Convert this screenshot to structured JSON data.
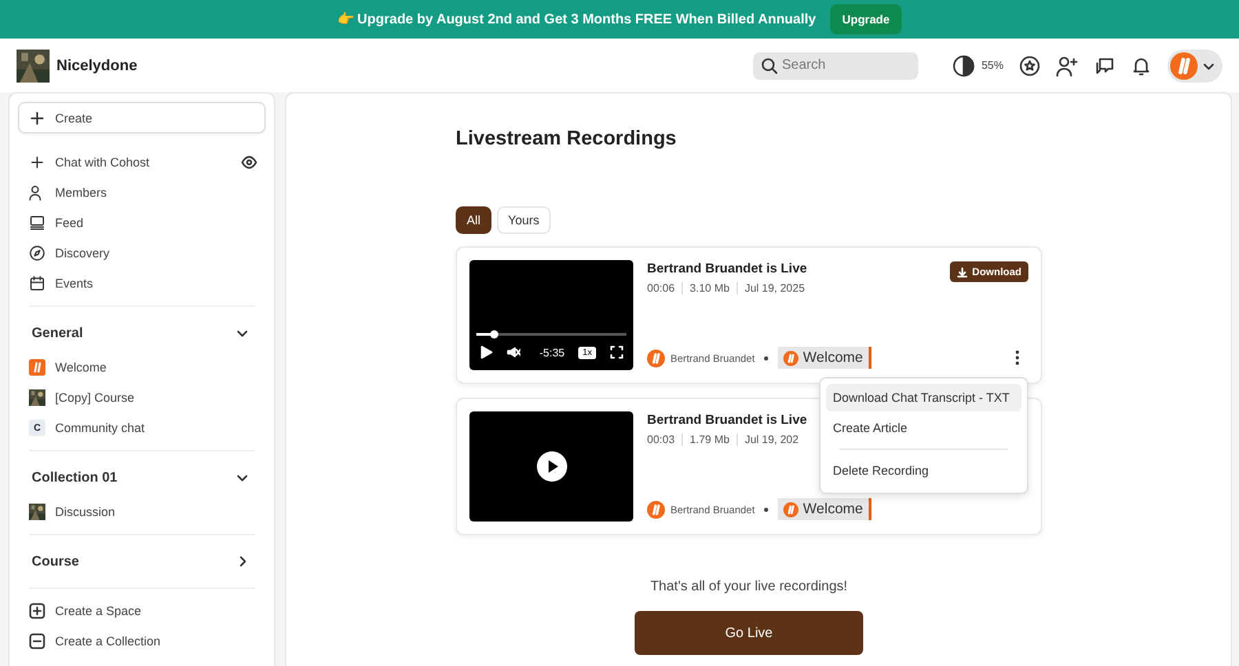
{
  "banner": {
    "icon": "👉",
    "text": "Upgrade by August 2nd and Get 3 Months FREE When Billed Annually",
    "button": "Upgrade"
  },
  "header": {
    "community": "Nicelydone",
    "search_placeholder": "Search",
    "theme_reading": "55%"
  },
  "sidebar": {
    "create": "Create",
    "nav": [
      {
        "label": "Chat with Cohost",
        "visible": true
      },
      {
        "label": "Members"
      },
      {
        "label": "Feed"
      },
      {
        "label": "Discovery"
      },
      {
        "label": "Events"
      }
    ],
    "sections": [
      {
        "title": "General",
        "expanded": true,
        "items": [
          {
            "label": "Welcome",
            "kind": "logo"
          },
          {
            "label": "[Copy] Course",
            "kind": "picture"
          },
          {
            "label": "Community chat",
            "kind": "letter",
            "letter": "C"
          }
        ]
      },
      {
        "title": "Collection 01",
        "expanded": true,
        "items": [
          {
            "label": "Discussion",
            "kind": "picture"
          }
        ]
      },
      {
        "title": "Course",
        "expanded": false
      }
    ],
    "actions": [
      "Create a Space",
      "Create a Collection"
    ]
  },
  "main": {
    "title": "Livestream Recordings",
    "filters": [
      {
        "label": "All",
        "selected": true
      },
      {
        "label": "Yours",
        "selected": false
      }
    ],
    "recordings": [
      {
        "title": "Bertrand Bruandet is Live",
        "duration": "00:06",
        "size": "3.10 Mb",
        "date": "Jul 19, 2025",
        "author": "Bertrand Bruandet",
        "space": "Welcome",
        "download": "Download",
        "player": {
          "kind": "controls",
          "level": 0.12,
          "remaining": "-5:35",
          "speed": "1x"
        }
      },
      {
        "title": "Bertrand Bruandet is Live",
        "duration": "00:03",
        "size": "1.79 Mb",
        "date": "Jul 19, 202",
        "author": "Bertrand Bruandet",
        "space": "Welcome",
        "player": {
          "kind": "idle"
        }
      }
    ],
    "menu": [
      {
        "label": "Download Chat Transcript - TXT",
        "selected": true,
        "divider_before": false
      },
      {
        "label": "Create Article",
        "selected": false,
        "divider_before": false
      },
      {
        "label": "Delete Recording",
        "selected": false,
        "divider_before": true
      }
    ],
    "end_message": "That's all of your live recordings!",
    "go_live": "Go Live"
  }
}
